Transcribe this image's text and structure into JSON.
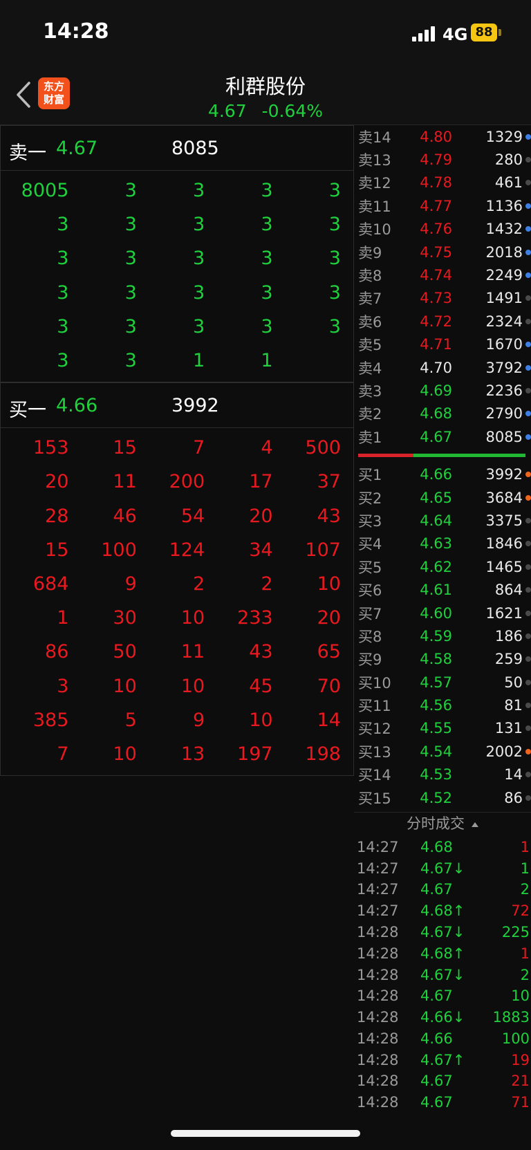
{
  "status": {
    "time": "14:28",
    "network": "4G",
    "battery": "88"
  },
  "header": {
    "logo_line1": "东方",
    "logo_line2": "财富",
    "name": "利群股份",
    "price": "4.67",
    "change_pct": "-0.64%"
  },
  "sell_queue": {
    "label": "卖一",
    "price": "4.67",
    "volume": "8085",
    "rows": [
      [
        "8005",
        "3",
        "3",
        "3",
        "3"
      ],
      [
        "3",
        "3",
        "3",
        "3",
        "3"
      ],
      [
        "3",
        "3",
        "3",
        "3",
        "3"
      ],
      [
        "3",
        "3",
        "3",
        "3",
        "3"
      ],
      [
        "3",
        "3",
        "3",
        "3",
        "3"
      ],
      [
        "3",
        "3",
        "1",
        "1",
        ""
      ]
    ]
  },
  "buy_queue": {
    "label": "买一",
    "price": "4.66",
    "volume": "3992",
    "rows": [
      [
        "153",
        "15",
        "7",
        "4",
        "500"
      ],
      [
        "20",
        "11",
        "200",
        "17",
        "37"
      ],
      [
        "28",
        "46",
        "54",
        "20",
        "43"
      ],
      [
        "15",
        "100",
        "124",
        "34",
        "107"
      ],
      [
        "684",
        "9",
        "2",
        "2",
        "10"
      ],
      [
        "1",
        "30",
        "10",
        "233",
        "20"
      ],
      [
        "86",
        "50",
        "11",
        "43",
        "65"
      ],
      [
        "3",
        "10",
        "10",
        "45",
        "70"
      ],
      [
        "385",
        "5",
        "9",
        "10",
        "14"
      ],
      [
        "7",
        "10",
        "13",
        "197",
        "198"
      ]
    ]
  },
  "asks": [
    {
      "label": "卖14",
      "price": "4.80",
      "vol": "1329",
      "color": "red",
      "dot": "blue"
    },
    {
      "label": "卖13",
      "price": "4.79",
      "vol": "280",
      "color": "red",
      "dot": "grey"
    },
    {
      "label": "卖12",
      "price": "4.78",
      "vol": "461",
      "color": "red",
      "dot": "grey"
    },
    {
      "label": "卖11",
      "price": "4.77",
      "vol": "1136",
      "color": "red",
      "dot": "blue"
    },
    {
      "label": "卖10",
      "price": "4.76",
      "vol": "1432",
      "color": "red",
      "dot": "blue"
    },
    {
      "label": "卖9",
      "price": "4.75",
      "vol": "2018",
      "color": "red",
      "dot": "blue"
    },
    {
      "label": "卖8",
      "price": "4.74",
      "vol": "2249",
      "color": "red",
      "dot": "blue"
    },
    {
      "label": "卖7",
      "price": "4.73",
      "vol": "1491",
      "color": "red",
      "dot": "grey"
    },
    {
      "label": "卖6",
      "price": "4.72",
      "vol": "2324",
      "color": "red",
      "dot": "grey"
    },
    {
      "label": "卖5",
      "price": "4.71",
      "vol": "1670",
      "color": "red",
      "dot": "blue"
    },
    {
      "label": "卖4",
      "price": "4.70",
      "vol": "3792",
      "color": "white",
      "dot": "blue"
    },
    {
      "label": "卖3",
      "price": "4.69",
      "vol": "2236",
      "color": "green",
      "dot": "grey"
    },
    {
      "label": "卖2",
      "price": "4.68",
      "vol": "2790",
      "color": "green",
      "dot": "blue"
    },
    {
      "label": "卖1",
      "price": "4.67",
      "vol": "8085",
      "color": "green",
      "dot": "blue"
    }
  ],
  "bids": [
    {
      "label": "买1",
      "price": "4.66",
      "vol": "3992",
      "color": "green",
      "dot": "orange"
    },
    {
      "label": "买2",
      "price": "4.65",
      "vol": "3684",
      "color": "green",
      "dot": "orange"
    },
    {
      "label": "买3",
      "price": "4.64",
      "vol": "3375",
      "color": "green",
      "dot": "grey"
    },
    {
      "label": "买4",
      "price": "4.63",
      "vol": "1846",
      "color": "green",
      "dot": "grey"
    },
    {
      "label": "买5",
      "price": "4.62",
      "vol": "1465",
      "color": "green",
      "dot": "grey"
    },
    {
      "label": "买6",
      "price": "4.61",
      "vol": "864",
      "color": "green",
      "dot": "grey"
    },
    {
      "label": "买7",
      "price": "4.60",
      "vol": "1621",
      "color": "green",
      "dot": "grey"
    },
    {
      "label": "买8",
      "price": "4.59",
      "vol": "186",
      "color": "green",
      "dot": "grey"
    },
    {
      "label": "买9",
      "price": "4.58",
      "vol": "259",
      "color": "green",
      "dot": "grey"
    },
    {
      "label": "买10",
      "price": "4.57",
      "vol": "50",
      "color": "green",
      "dot": "grey"
    },
    {
      "label": "买11",
      "price": "4.56",
      "vol": "81",
      "color": "green",
      "dot": "grey"
    },
    {
      "label": "买12",
      "price": "4.55",
      "vol": "131",
      "color": "green",
      "dot": "grey"
    },
    {
      "label": "买13",
      "price": "4.54",
      "vol": "2002",
      "color": "green",
      "dot": "orange"
    },
    {
      "label": "买14",
      "price": "4.53",
      "vol": "14",
      "color": "green",
      "dot": "grey"
    },
    {
      "label": "买15",
      "price": "4.52",
      "vol": "86",
      "color": "green",
      "dot": "grey"
    }
  ],
  "ticks_title": "分时成交",
  "ticks": [
    {
      "time": "14:27",
      "price": "4.68",
      "vol": "1",
      "vol_color": "red"
    },
    {
      "time": "14:27",
      "price": "4.67↓",
      "vol": "1",
      "vol_color": "green"
    },
    {
      "time": "14:27",
      "price": "4.67",
      "vol": "2",
      "vol_color": "green"
    },
    {
      "time": "14:27",
      "price": "4.68↑",
      "vol": "72",
      "vol_color": "red"
    },
    {
      "time": "14:28",
      "price": "4.67↓",
      "vol": "225",
      "vol_color": "green"
    },
    {
      "time": "14:28",
      "price": "4.68↑",
      "vol": "1",
      "vol_color": "red"
    },
    {
      "time": "14:28",
      "price": "4.67↓",
      "vol": "2",
      "vol_color": "green"
    },
    {
      "time": "14:28",
      "price": "4.67",
      "vol": "10",
      "vol_color": "green"
    },
    {
      "time": "14:28",
      "price": "4.66↓",
      "vol": "1883",
      "vol_color": "green"
    },
    {
      "time": "14:28",
      "price": "4.66",
      "vol": "100",
      "vol_color": "green"
    },
    {
      "time": "14:28",
      "price": "4.67↑",
      "vol": "19",
      "vol_color": "red"
    },
    {
      "time": "14:28",
      "price": "4.67",
      "vol": "21",
      "vol_color": "red"
    },
    {
      "time": "14:28",
      "price": "4.67",
      "vol": "71",
      "vol_color": "red"
    }
  ]
}
